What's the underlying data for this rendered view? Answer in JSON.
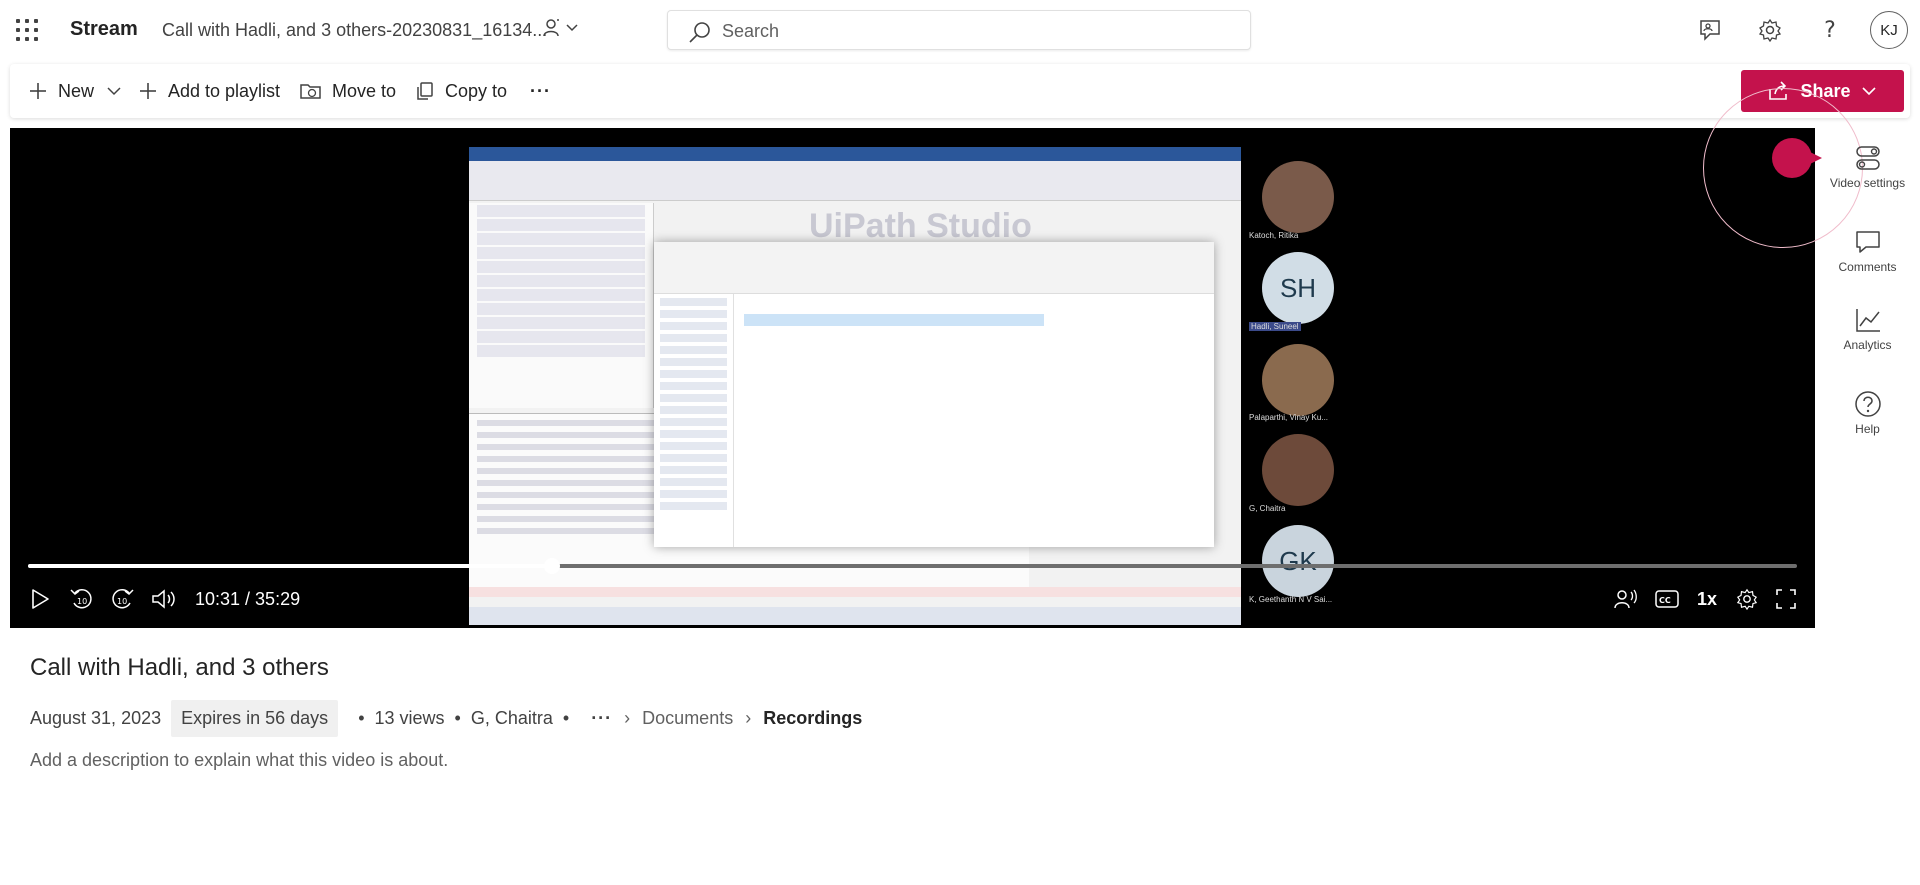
{
  "app": {
    "name": "Stream",
    "doc_title": "Call with Hadli, and 3 others-20230831_16134...",
    "search_placeholder": "Search",
    "avatar_initials": "KJ"
  },
  "commands": {
    "new": "New",
    "add_to_playlist": "Add to playlist",
    "move_to": "Move to",
    "copy_to": "Copy to",
    "more": "···",
    "share": "Share"
  },
  "player": {
    "current_time": "10:31",
    "separator": " / ",
    "duration": "35:29",
    "time_display": "10:31 / 35:29",
    "progress_fraction": 0.296,
    "speed": "1x",
    "participants": [
      {
        "initials": "",
        "name": "Katoch, Ritika",
        "color": "#7a5a4a"
      },
      {
        "initials": "SH",
        "name": "Hadli, Suneel",
        "color": "#d1dde6"
      },
      {
        "initials": "",
        "name": "Palaparthi, Vinay Ku...",
        "color": "#8a6a4e"
      },
      {
        "initials": "",
        "name": "G, Chaitra",
        "color": "#6d4a3a"
      },
      {
        "initials": "GK",
        "name": "K, Geethanth N V Sai...",
        "color": "#c9d4dd"
      }
    ]
  },
  "rail": {
    "video_settings": "Video settings",
    "comments": "Comments",
    "analytics": "Analytics",
    "help": "Help"
  },
  "video": {
    "title": "Call with Hadli, and 3 others",
    "date": "August 31, 2023",
    "expires": "Expires in 56 days",
    "bullet": "•",
    "views": "13 views",
    "owner": "G, Chaitra",
    "breadcrumb_more": "···",
    "breadcrumb": [
      "Documents",
      "Recordings"
    ],
    "description_placeholder": "Add a description to explain what this video is about."
  },
  "colors": {
    "accent": "#c4124c",
    "player_bg": "#000000"
  }
}
